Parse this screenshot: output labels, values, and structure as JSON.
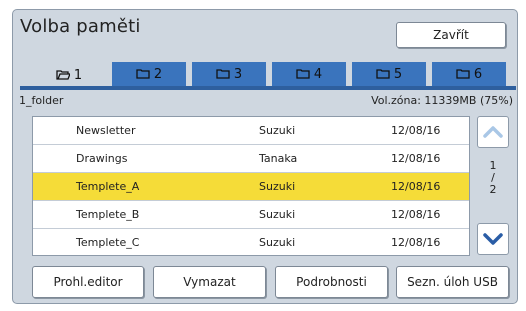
{
  "window": {
    "title": "Volba paměti",
    "close_label": "Zavřít"
  },
  "tabs": [
    {
      "label": "1",
      "active": true
    },
    {
      "label": "2",
      "active": false
    },
    {
      "label": "3",
      "active": false
    },
    {
      "label": "4",
      "active": false
    },
    {
      "label": "5",
      "active": false
    },
    {
      "label": "6",
      "active": false
    }
  ],
  "folder_name": "1_folder",
  "volume_info": "Vol.zóna: 11339MB (75%)",
  "files": [
    {
      "name": "Newsletter",
      "owner": "Suzuki",
      "date": "12/08/16",
      "selected": false
    },
    {
      "name": "Drawings",
      "owner": "Tanaka",
      "date": "12/08/16",
      "selected": false
    },
    {
      "name": "Templete_A",
      "owner": "Suzuki",
      "date": "12/08/16",
      "selected": true
    },
    {
      "name": "Templete_B",
      "owner": "Suzuki",
      "date": "12/08/16",
      "selected": false
    },
    {
      "name": "Templete_C",
      "owner": "Suzuki",
      "date": "12/08/16",
      "selected": false
    }
  ],
  "pagination": {
    "current": "1",
    "separator": "/",
    "total": "2"
  },
  "buttons": {
    "preview_editor": "Prohl.editor",
    "delete": "Vymazat",
    "details": "Podrobnosti",
    "usb_jobs": "Sezn. úloh USB"
  },
  "colors": {
    "tab_blue": "#3a74bd",
    "selected_row": "#f5dc38",
    "panel_bg": "#cfd7e0",
    "scroll_arrow": "#2a5da6"
  }
}
